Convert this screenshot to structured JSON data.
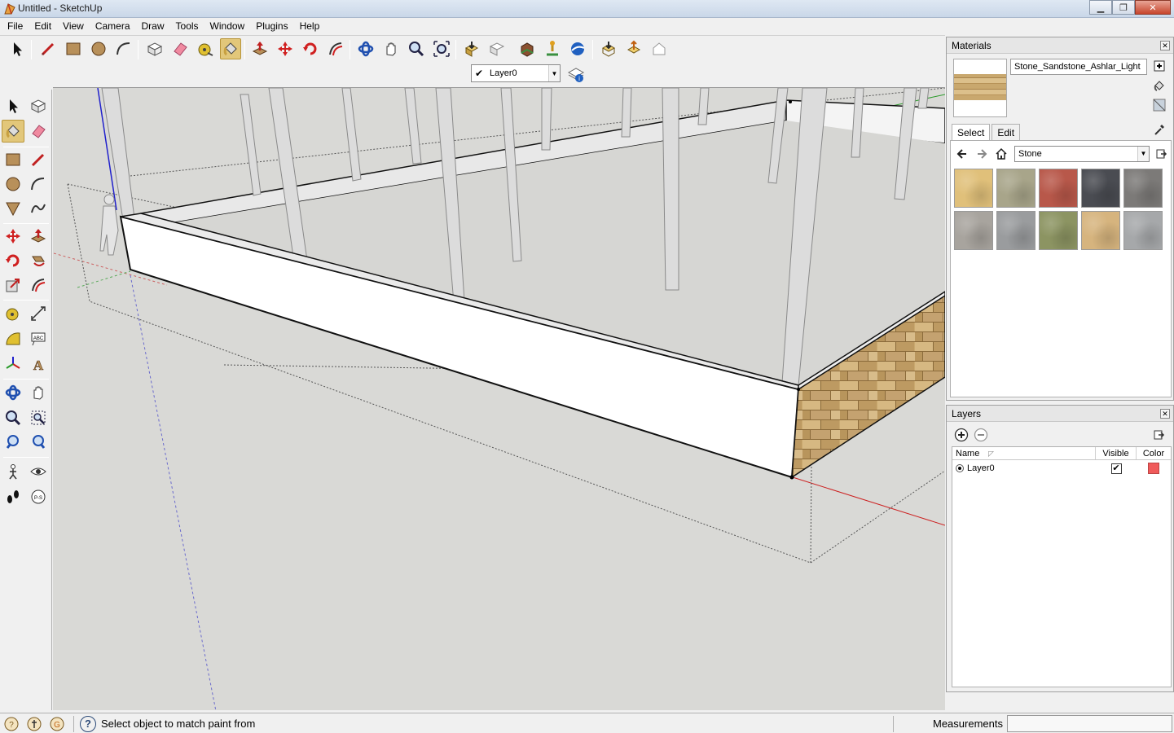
{
  "window": {
    "title": "Untitled - SketchUp",
    "minimize_glyph": "▁",
    "maximize_glyph": "❐",
    "close_glyph": "✕"
  },
  "menu": [
    "File",
    "Edit",
    "View",
    "Camera",
    "Draw",
    "Tools",
    "Window",
    "Plugins",
    "Help"
  ],
  "layer_toolbar": {
    "check": "✔",
    "current_layer": "Layer0",
    "arrow": "▼"
  },
  "materials_panel": {
    "title": "Materials",
    "close_glyph": "✕",
    "material_name": "Stone_Sandstone_Ashlar_Light",
    "tabs": [
      "Select",
      "Edit"
    ],
    "collection": "Stone",
    "collection_arrow": "▼",
    "swatch_colors": [
      "#e0c07a",
      "#a8a58a",
      "#b8584a",
      "#4a4c52",
      "#7c7a78",
      "#a8a49e",
      "#9a9c9e",
      "#8c9462",
      "#d6b47e",
      "#a6a8aa"
    ]
  },
  "layers_panel": {
    "title": "Layers",
    "close_glyph": "✕",
    "columns": {
      "name": "Name",
      "sort_glyph": "◸",
      "visible": "Visible",
      "color": "Color"
    },
    "rows": [
      {
        "name": "Layer0",
        "visible_glyph": "✔",
        "color": "#f05a5a"
      }
    ]
  },
  "statusbar": {
    "help_glyph": "?",
    "message": "Select object to match paint from",
    "measurements_label": "Measurements",
    "measurements_value": ""
  },
  "colors": {
    "viewport_bg": "#d9d9d6",
    "red_axis": "#cc2020",
    "green_axis": "#2a9a2a",
    "blue_axis": "#2020cc",
    "stone": "#c9a86e"
  }
}
